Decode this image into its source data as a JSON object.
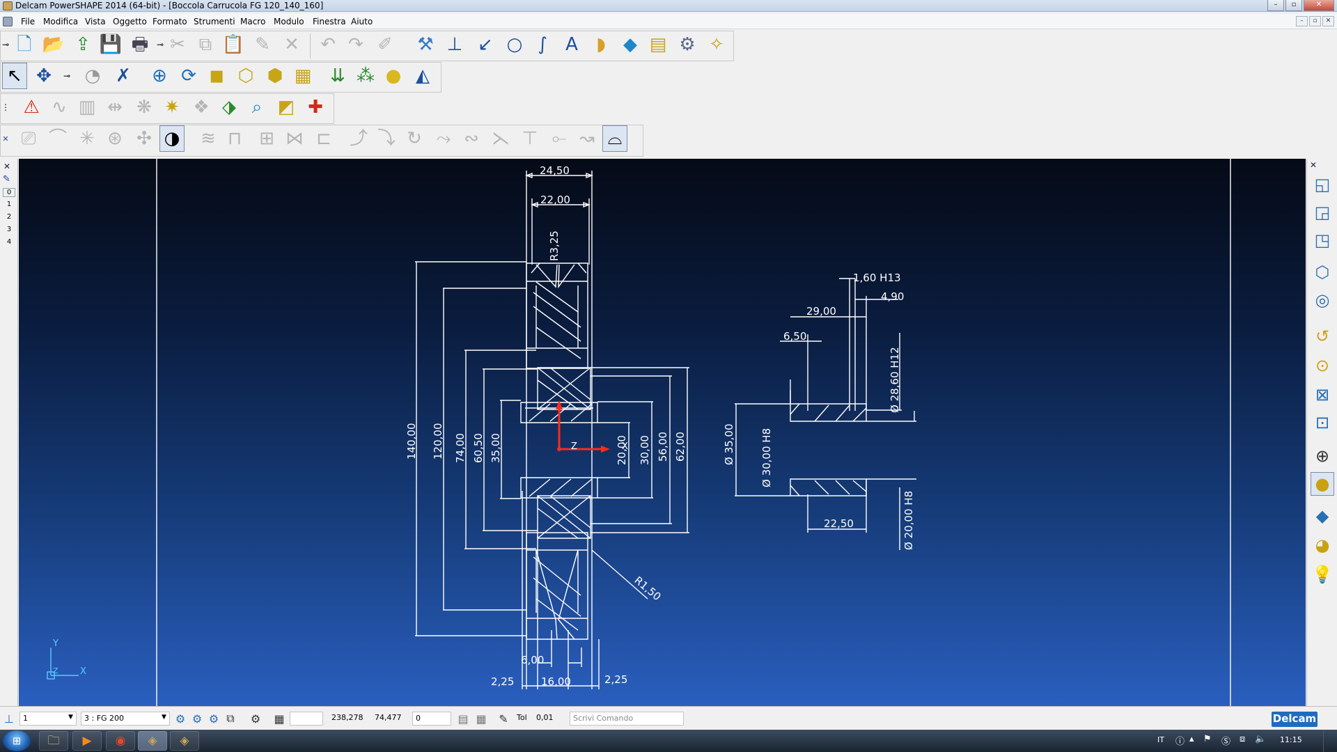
{
  "window": {
    "title": "Delcam PowerSHAPE 2014 (64-bit) - [Boccola Carrucola FG 120_140_160]",
    "controls": [
      "–",
      "▫",
      "✕"
    ]
  },
  "menu": {
    "items": [
      "File",
      "Modifica",
      "Vista",
      "Oggetto",
      "Formato",
      "Strumenti",
      "Macro",
      "Modulo",
      "Finestra",
      "Aiuto"
    ],
    "mdi_controls": [
      "–",
      "▫",
      "✕"
    ]
  },
  "toolbars": {
    "row1": [
      "pin",
      "new-model",
      "open-model",
      "import",
      "save",
      "print",
      "pin2",
      "cut",
      "copy",
      "paste",
      "edit-pencil",
      "delete",
      "undo",
      "redo",
      "sketch",
      "general-edits",
      "workplane",
      "line",
      "circle",
      "curve",
      "text",
      "surface",
      "solid",
      "mesh",
      "features",
      "wizard"
    ],
    "row2": [
      "select",
      "transform",
      "pin",
      "arc",
      "line-tools",
      "workplane-add",
      "rotate",
      "view-front",
      "view-box",
      "view-iso",
      "view-multi",
      "array",
      "pattern",
      "sphere",
      "shape"
    ],
    "row3": [
      "grip",
      "warning",
      "bridge",
      "block",
      "tool1",
      "tool2",
      "wizard2",
      "tool3",
      "tool4",
      "tool5",
      "tool6",
      "medical"
    ],
    "row4": [
      "close",
      "t1",
      "t2",
      "t3",
      "t4",
      "t5",
      "t6",
      "t7",
      "t8",
      "t9",
      "t10",
      "t11",
      "c1",
      "c2",
      "c3",
      "c4",
      "c5",
      "c6",
      "c7",
      "c8",
      "c9",
      "c10"
    ]
  },
  "left_panel": {
    "levels": [
      "0",
      "1",
      "2",
      "3",
      "4"
    ]
  },
  "drawing": {
    "dims": {
      "d_24_50": "24,50",
      "d_22_00": "22,00",
      "d_R3_25": "R3,25",
      "d_140": "140,00",
      "d_120": "120,00",
      "d_74": "74,00",
      "d_60_50": "60,50",
      "d_35": "35,00",
      "d_20": "20,00",
      "d_30": "30,00",
      "d_56": "56,00",
      "d_62": "62,00",
      "d_R1_50": "R1,50",
      "d_6_00": "6,00",
      "d_16_00": "16,00",
      "d_2_25_left": "2,25",
      "d_2_25_right": "2,25",
      "r_1_60": "1,60 H13",
      "r_4_90": "4,90",
      "r_29_00": "29,00",
      "r_6_50": "6,50",
      "r_phi_28_60": "Ø 28,60 H12",
      "r_phi_35": "Ø 35,00",
      "r_phi_30": "Ø 30,00 H8",
      "r_22_50": "22,50",
      "r_phi_20": "Ø 20,00 H8"
    },
    "axes": {
      "z": "Z",
      "x": "X",
      "y": "Y"
    }
  },
  "status": {
    "level_value": "1",
    "material_value": "3  : FG 200",
    "coord_x": "238,278",
    "coord_y": "74,477",
    "coord_z": "0",
    "tol_label": "Tol",
    "tol_value": "0,01",
    "command_placeholder": "Scrivi Comando",
    "brand": "Delcam"
  },
  "taskbar": {
    "lang": "IT",
    "time": "11:15"
  },
  "colors": {
    "viewport_top": "#050a16",
    "viewport_bottom": "#2a5fbf",
    "drawing_line": "#ffffff",
    "axis_red": "#ff2a1a"
  }
}
